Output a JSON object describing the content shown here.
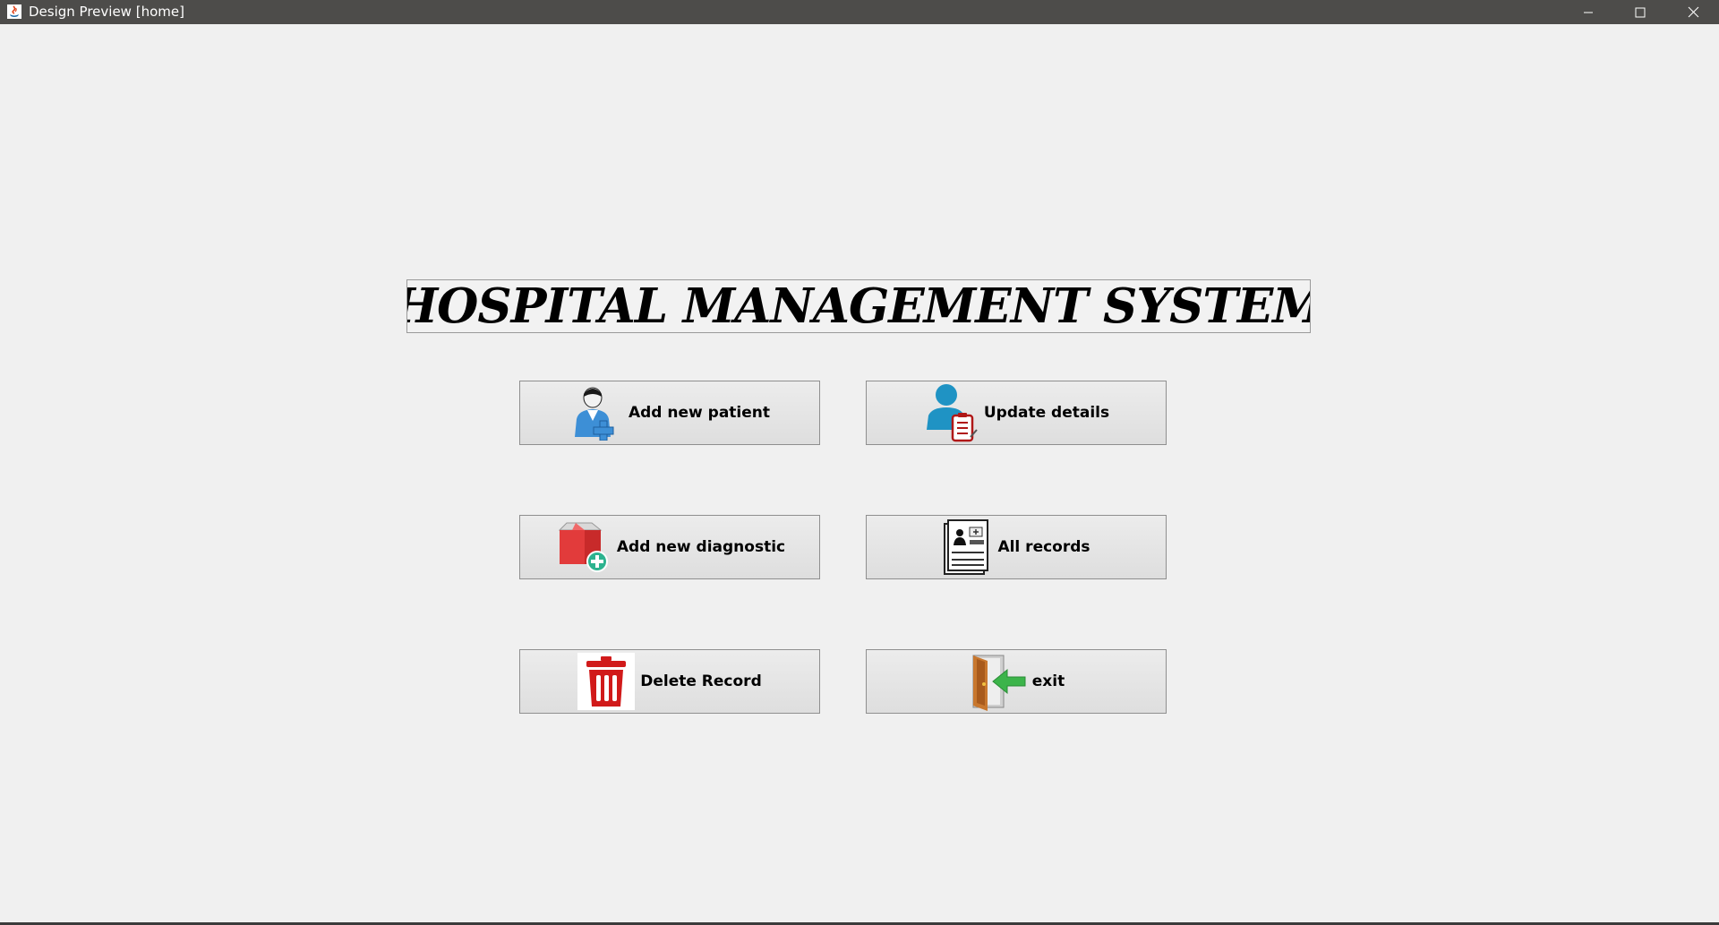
{
  "window": {
    "title": "Design Preview [home]",
    "controls": {
      "minimize_icon": "minimize-icon",
      "maximize_icon": "maximize-icon",
      "close_icon": "close-icon"
    },
    "titlebar_color": "#4d4c4a"
  },
  "main": {
    "title": "HOSPITAL MANAGEMENT SYSTEM",
    "background_color": "#f0f0f0",
    "buttons": [
      {
        "id": "add_patient",
        "label": "Add new patient",
        "icon": "add-patient-icon"
      },
      {
        "id": "update_details",
        "label": "Update details",
        "icon": "update-details-icon"
      },
      {
        "id": "add_diagnostic",
        "label": "Add new diagnostic",
        "icon": "add-diagnostic-icon"
      },
      {
        "id": "all_records",
        "label": "All records",
        "icon": "records-icon"
      },
      {
        "id": "delete_record",
        "label": "Delete Record",
        "icon": "trash-icon"
      },
      {
        "id": "exit",
        "label": "exit",
        "icon": "exit-door-icon"
      }
    ]
  }
}
